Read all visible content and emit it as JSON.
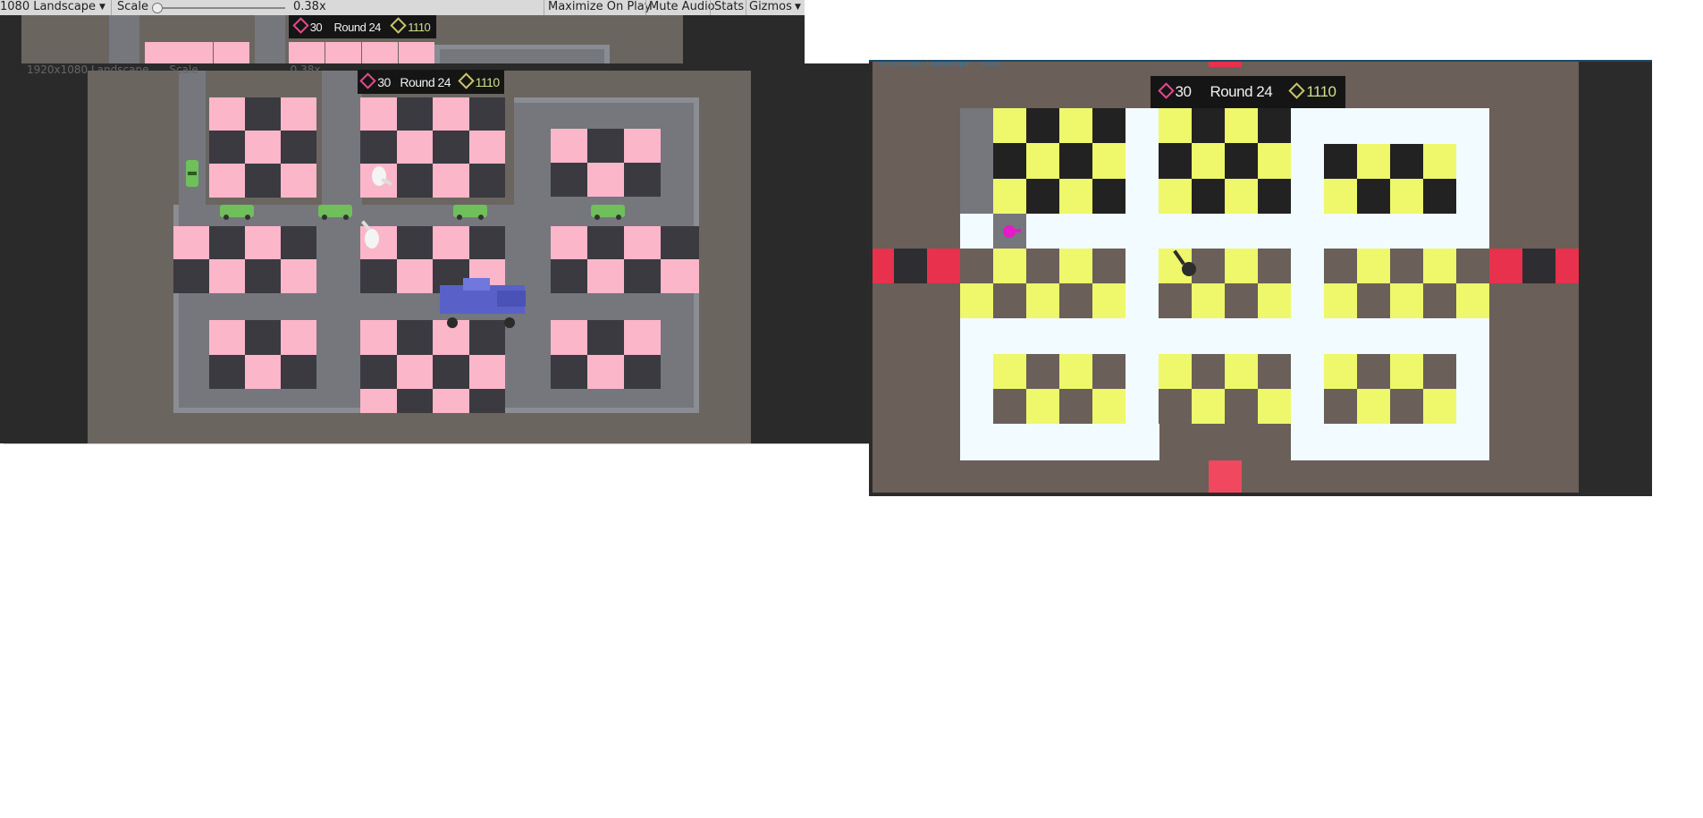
{
  "toolbar": {
    "resolution": "1080 Landscape",
    "scale_label": "Scale",
    "scale_value": "0.38x",
    "maximize_label": "Maximize On Play",
    "mute_label": "Mute Audio",
    "stats_label": "Stats",
    "gizmos_label": "Gizmos"
  },
  "hud": {
    "lives": "30",
    "round": "Round 24",
    "gold": "1110"
  },
  "colors": {
    "pink_tile": "#fbb6c9",
    "dark_tile": "#3a3a40",
    "yellow_tile": "#eef86a",
    "ground": "#6a5f59",
    "road": "#75777d",
    "wall": "#f2fbff",
    "spawn_red": "#e8314c"
  }
}
